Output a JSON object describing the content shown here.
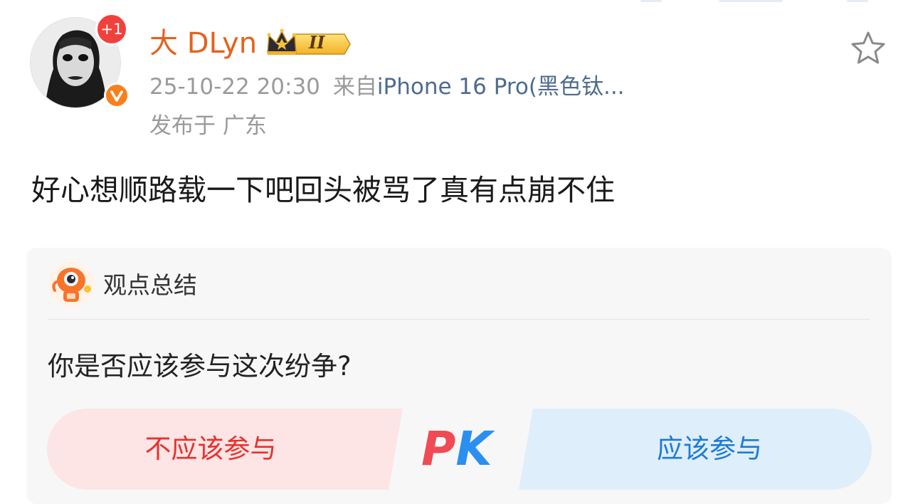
{
  "post": {
    "author": {
      "name": "大 DLyn",
      "notification_badge": "+1",
      "vip_level": "II",
      "verified_icon": "v-verified-icon"
    },
    "time": "25-10-22 20:30",
    "source_prefix": "来自",
    "device": "iPhone 16 Pro(黑色钛...",
    "location": "发布于 广东",
    "text": "好心想顺路载一下吧回头被骂了真有点崩不住"
  },
  "summary_card": {
    "title": "观点总结",
    "question": "你是否应该参与这次纷争?",
    "option_no": "不应该参与",
    "option_yes": "应该参与",
    "pk_p": "P",
    "pk_k": "K"
  },
  "colors": {
    "username": "#e4631c",
    "device_link": "#4e6b8f",
    "option_no": "#e5322d",
    "option_yes": "#1d7bd6"
  }
}
